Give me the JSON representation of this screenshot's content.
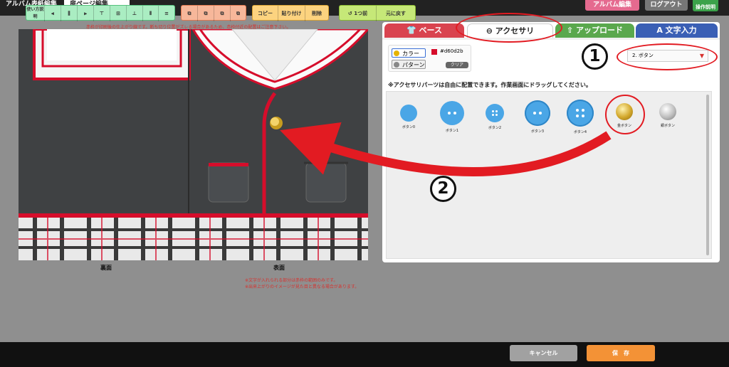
{
  "header": {
    "tab_cover": "アルバム表紙編集",
    "tab_page": "扉ページ編集",
    "btn_album": "アルバム編集",
    "btn_logout": "ログアウト",
    "btn_help": "操作説明"
  },
  "canvas": {
    "notice_top": "赤枠が印刷後の仕上がり線です。断ち切り位置がズレる場合があるため、赤枠付近の配置はご注意下さい。",
    "label_back": "裏面",
    "label_front": "表面",
    "notice_bottom_1": "※文字が入れられる部分は赤枠の範囲のみです。",
    "notice_bottom_2": "※出来上がりのイメージが見た目と異なる場合があります。"
  },
  "panel": {
    "tabs": [
      {
        "label": "ベース",
        "icon": "shirt-icon"
      },
      {
        "label": "アクセサリ",
        "icon": "accessory-icon"
      },
      {
        "label": "アップロード",
        "icon": "upload-icon"
      },
      {
        "label": "文字入力",
        "icon": "text-icon"
      }
    ],
    "color_button": "カラー",
    "pattern_button": "パターン",
    "color_hex": "#d60d2b",
    "clear_button": "クリア",
    "select_value": "2. ボタン",
    "instruction": "※アクセサリパーツは自由に配置できます。作業画面にドラッグしてください。",
    "items": [
      {
        "label": "ボタン0",
        "type": "blue-plain"
      },
      {
        "label": "ボタン1",
        "type": "blue-2hole"
      },
      {
        "label": "ボタン2",
        "type": "blue-4hole-small"
      },
      {
        "label": "ボタン3",
        "type": "blue-2hole-ring"
      },
      {
        "label": "ボタン4",
        "type": "blue-4hole-ring"
      },
      {
        "label": "金ボタン",
        "type": "gold"
      },
      {
        "label": "銀ボタン",
        "type": "silver"
      }
    ]
  },
  "annotations": {
    "step1": "1",
    "step2": "2"
  },
  "toolbar": {
    "help": "使い方説明",
    "copy": "コピー",
    "paste": "貼り付け",
    "delete": "削除",
    "undo": "1つ前",
    "reset": "元に戻す",
    "cancel": "キャンセル",
    "save": "保　存"
  },
  "colors": {
    "accent_red": "#d60d2b",
    "tab_base": "#d9434f",
    "tab_upload": "#5aa84d",
    "tab_text": "#3a5fb5",
    "save": "#f39236"
  }
}
